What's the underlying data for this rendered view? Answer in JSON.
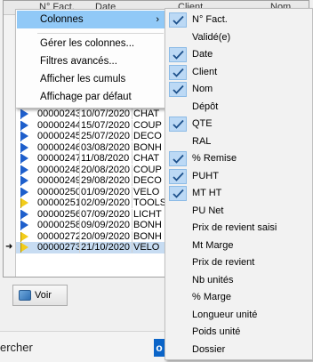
{
  "grid": {
    "headers": [
      "N° Fact.",
      "Date",
      "Client",
      "Nom"
    ],
    "rows": [
      {
        "num": "00000243",
        "date": "10/07/2020",
        "client": "CHAT",
        "flag": "blue"
      },
      {
        "num": "00000244",
        "date": "15/07/2020",
        "client": "COUP",
        "flag": "blue"
      },
      {
        "num": "00000245",
        "date": "25/07/2020",
        "client": "DECO",
        "flag": "blue"
      },
      {
        "num": "00000246",
        "date": "03/08/2020",
        "client": "BONH",
        "flag": "blue"
      },
      {
        "num": "00000247",
        "date": "11/08/2020",
        "client": "CHAT",
        "flag": "blue"
      },
      {
        "num": "00000248",
        "date": "20/08/2020",
        "client": "COUP",
        "flag": "blue"
      },
      {
        "num": "00000249",
        "date": "29/08/2020",
        "client": "DECO",
        "flag": "blue"
      },
      {
        "num": "00000250",
        "date": "01/09/2020",
        "client": "VELO",
        "flag": "blue"
      },
      {
        "num": "00000251",
        "date": "02/09/2020",
        "client": "TOOLS",
        "flag": "yellow"
      },
      {
        "num": "00000256",
        "date": "07/09/2020",
        "client": "LICHT",
        "flag": "blue"
      },
      {
        "num": "00000258",
        "date": "09/09/2020",
        "client": "BONH",
        "flag": "blue"
      },
      {
        "num": "00000272",
        "date": "20/09/2020",
        "client": "BONH",
        "flag": "yellow"
      },
      {
        "num": "00000273",
        "date": "21/10/2020",
        "client": "VELO",
        "flag": "yellow",
        "selected": true
      }
    ],
    "pointer": "➜"
  },
  "voir_button": {
    "label": "Voir"
  },
  "taskbar": {
    "search_text": "ercher",
    "outlook_letter": "o"
  },
  "menu1": {
    "items": [
      {
        "label": "Colonnes",
        "has_submenu": true,
        "highlighted": true
      },
      {
        "label": "Gérer les colonnes..."
      },
      {
        "label": "Filtres avancés..."
      },
      {
        "label": "Afficher les cumuls"
      },
      {
        "label": "Affichage par défaut"
      }
    ],
    "submenu_arrow": "›"
  },
  "menu2": {
    "items": [
      {
        "label": "N° Fact.",
        "checked": true
      },
      {
        "label": "Validé(e)",
        "checked": false
      },
      {
        "label": "Date",
        "checked": true
      },
      {
        "label": "Client",
        "checked": true
      },
      {
        "label": "Nom",
        "checked": true
      },
      {
        "label": "Dépôt",
        "checked": false
      },
      {
        "label": "QTE",
        "checked": true
      },
      {
        "label": "RAL",
        "checked": false
      },
      {
        "label": "% Remise",
        "checked": true
      },
      {
        "label": "PUHT",
        "checked": true
      },
      {
        "label": "MT HT",
        "checked": true
      },
      {
        "label": "PU Net",
        "checked": false
      },
      {
        "label": "Prix de revient saisi",
        "checked": false
      },
      {
        "label": "Mt Marge",
        "checked": false
      },
      {
        "label": "Prix de revient",
        "checked": false
      },
      {
        "label": "Nb unités",
        "checked": false
      },
      {
        "label": "% Marge",
        "checked": false
      },
      {
        "label": "Longueur unité",
        "checked": false
      },
      {
        "label": "Poids unité",
        "checked": false
      },
      {
        "label": "Dossier",
        "checked": false
      }
    ]
  },
  "colors": {
    "menu_highlight": "#91c9f7",
    "check_bg": "#bcd9f5",
    "flag_blue": "#1e5fcc",
    "flag_yellow": "#f2cc1a",
    "selected_row": "#c7dcf2"
  }
}
